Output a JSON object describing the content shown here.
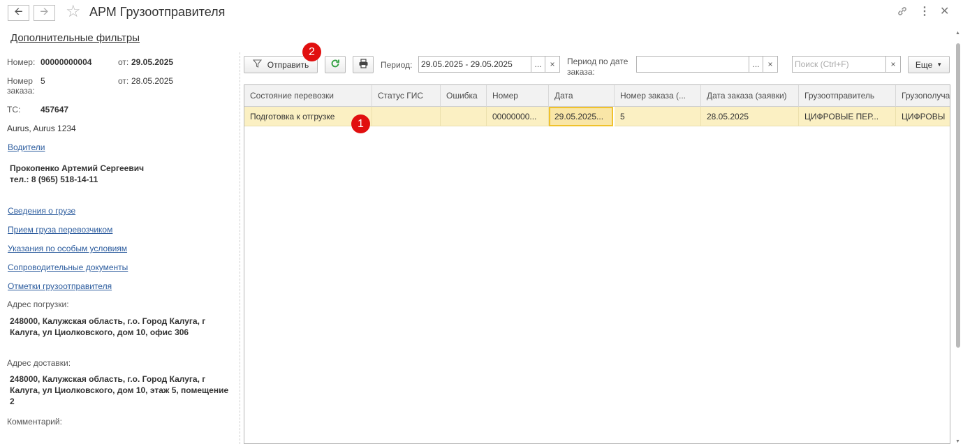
{
  "window": {
    "title": "АРМ Грузоотправителя"
  },
  "icons": {
    "back": "arrow-left-icon",
    "forward": "arrow-right-icon",
    "favorite": "star-icon",
    "link": "link-icon",
    "more": "more-vertical-icon",
    "close": "close-icon"
  },
  "left": {
    "filters_link": "Дополнительные фильтры",
    "number_label": "Номер:",
    "number_value": "00000000004",
    "number_date_label": "от:",
    "number_date_value": "29.05.2025",
    "order_label": "Номер заказа:",
    "order_value": "5",
    "order_date_label": "от:",
    "order_date_value": "28.05.2025",
    "vehicle_label": "ТС:",
    "vehicle_value": "457647",
    "vehicle_model": "Aurus, Aurus 1234",
    "drivers_link": "Водители",
    "driver_name": "Прокопенко Артемий Сергеевич",
    "driver_phone": "тел.: 8 (965) 518-14-11",
    "links": [
      "Сведения о грузе",
      "Прием груза перевозчиком",
      "Указания по особым условиям",
      "Сопроводительные документы",
      "Отметки грузоотправителя"
    ],
    "loading_address_label": "Адрес погрузки:",
    "loading_address": "248000, Калужская область, г.о. Город Калуга, г Калуга, ул Циолковского, дом 10, офис 306",
    "delivery_address_label": "Адрес доставки:",
    "delivery_address": "248000, Калужская область, г.о. Город Калуга, г Калуга, ул Циолковского, дом 10, этаж 5, помещение 2",
    "comment_label": "Комментарий:"
  },
  "toolbar": {
    "send_label": "Отправить",
    "period_label": "Период:",
    "period_value": "29.05.2025 - 29.05.2025",
    "order_period_label": "Период по дате заказа:",
    "order_period_value": "",
    "search_placeholder": "Поиск (Ctrl+F)",
    "more_label": "Еще",
    "ellipsis": "...",
    "clear": "×"
  },
  "badges": {
    "first": "1",
    "second": "2"
  },
  "table": {
    "columns": [
      "Состояние перевозки",
      "Статус ГИС",
      "Ошибка",
      "Номер",
      "Дата",
      "Номер заказа (...",
      "Дата заказа (заявки)",
      "Грузоотправитель",
      "Грузополуча"
    ],
    "rows": [
      {
        "cells": [
          "Подготовка к отгрузке",
          "",
          "",
          "00000000...",
          "29.05.2025...",
          "5",
          "28.05.2025",
          "ЦИФРОВЫЕ ПЕР...",
          "ЦИФРОВЫ"
        ]
      }
    ]
  },
  "colors": {
    "accent_link": "#2c5c9e",
    "selected_row": "#fbf0c3",
    "focus_cell_border": "#f0c22c",
    "badge": "#e10f0f",
    "refresh_icon": "#2e9e3d"
  }
}
